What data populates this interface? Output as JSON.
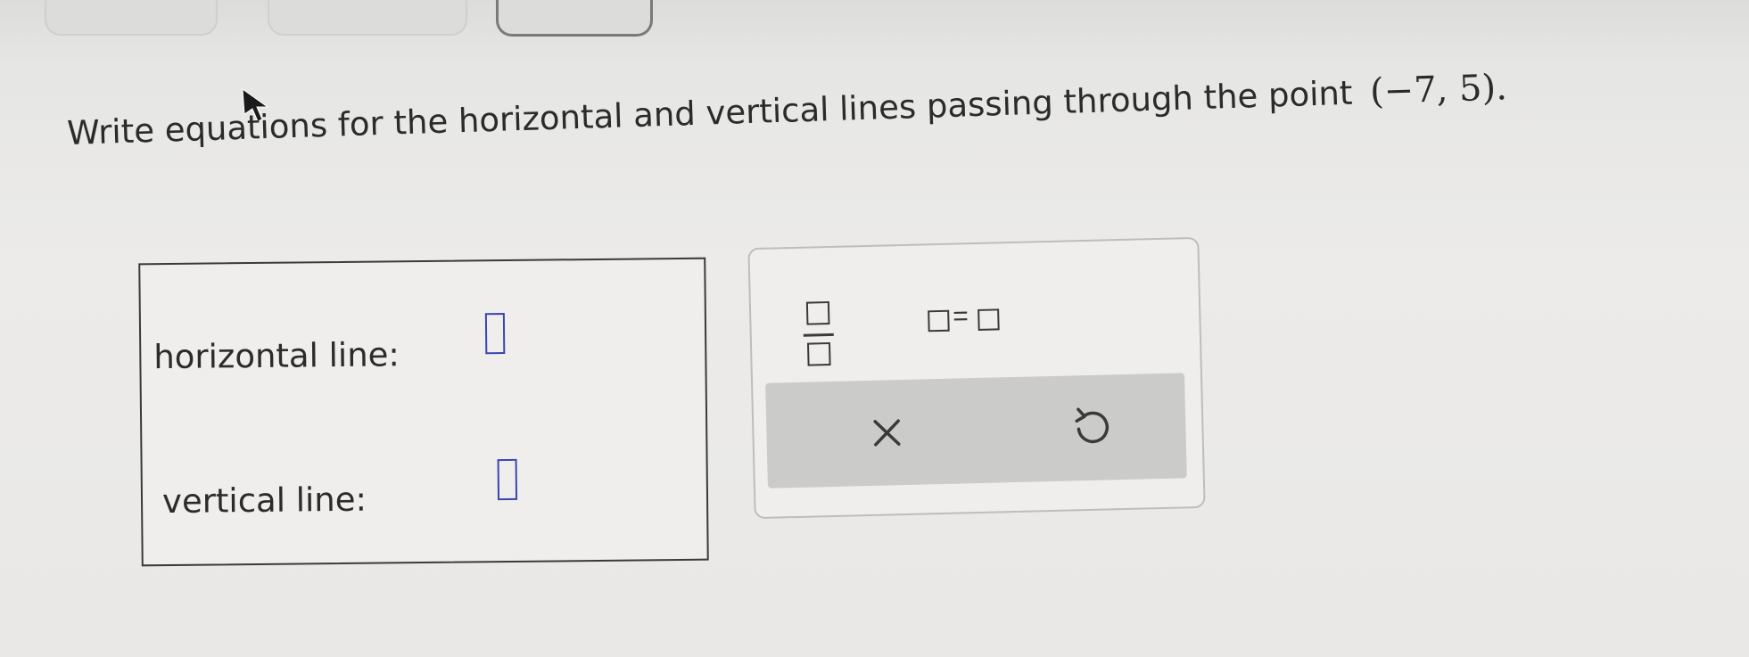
{
  "question": {
    "text": "Write equations for the horizontal and vertical lines passing through the point",
    "point": "(−7, 5)."
  },
  "answers": {
    "horizontal_label": "horizontal line:",
    "vertical_label": "vertical line:"
  },
  "toolbar": {
    "equals_symbol": "="
  },
  "icons": {
    "fraction": "fraction-icon",
    "equation": "equation-icon",
    "clear": "close-icon",
    "undo": "undo-icon"
  },
  "colors": {
    "blank_border": "#3c44b0",
    "action_bar": "#cbcbc9"
  }
}
